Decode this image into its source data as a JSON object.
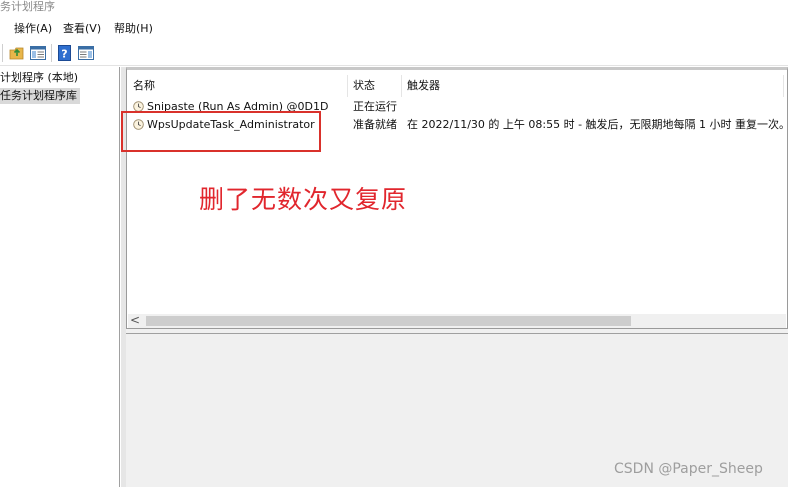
{
  "window": {
    "title": "务计划程序"
  },
  "menu": [
    {
      "label": "操作(A)"
    },
    {
      "label": "查看(V)"
    },
    {
      "label": "帮助(H)"
    }
  ],
  "toolbar": {
    "buttons": [
      "back-icon",
      "folder-up-icon",
      "console-tree-icon",
      "help-icon",
      "action-pane-icon"
    ]
  },
  "tree": [
    {
      "label": "计划程序 (本地)",
      "selected": false
    },
    {
      "label": "任务计划程序库",
      "selected": true
    }
  ],
  "table": {
    "headers": [
      "名称",
      "状态",
      "触发器"
    ],
    "rows": [
      {
        "name": "Snipaste (Run As Admin) @0D1D",
        "status": "正在运行",
        "trigger": ""
      },
      {
        "name": "WpsUpdateTask_Administrator",
        "status": "准备就绪",
        "trigger": "在 2022/11/30 的 上午 08:55 时 - 触发后，无限期地每隔 1 小时 重复一次。"
      }
    ]
  },
  "scrollbar": {
    "left_arrow": "<"
  },
  "annotation": {
    "text": "删了无数次又复原",
    "color": "#e1262d"
  },
  "watermark": "CSDN @Paper_Sheep"
}
